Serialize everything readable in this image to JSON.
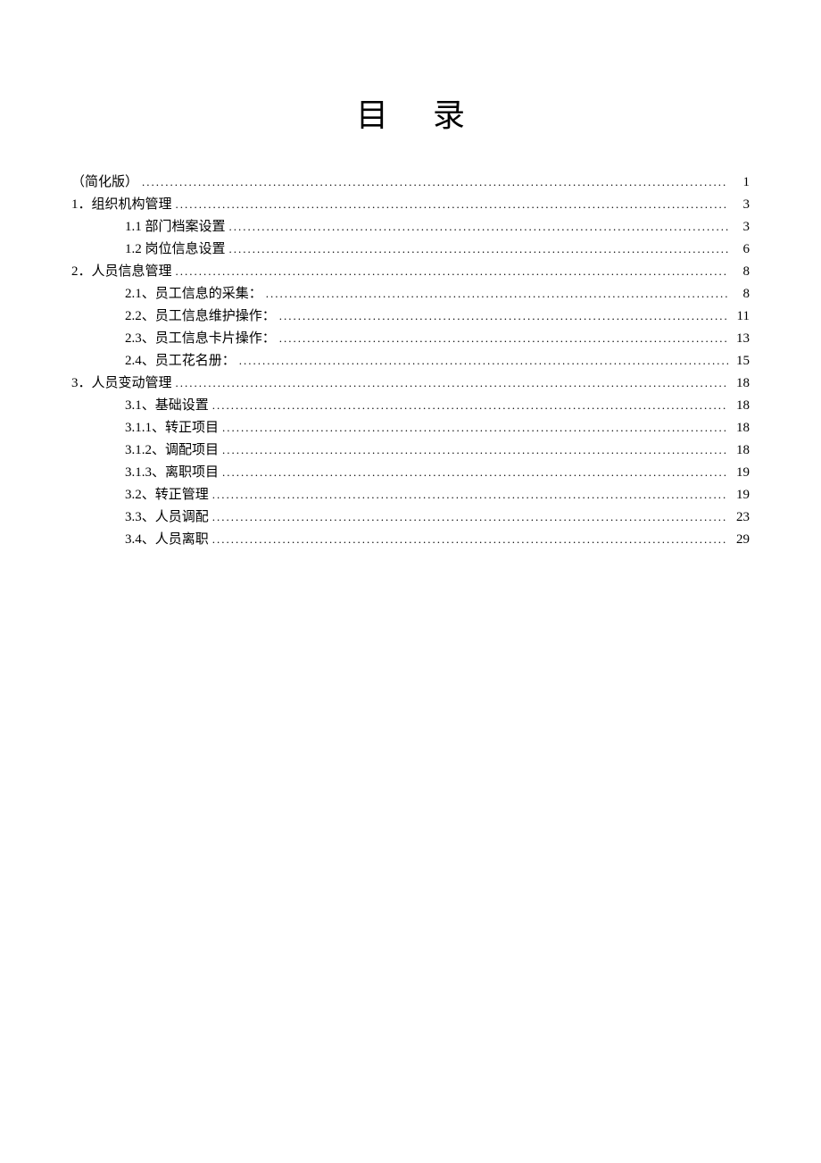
{
  "title": "目录",
  "entries": [
    {
      "level": 0,
      "label": "（简化版）",
      "page": "1"
    },
    {
      "level": 0,
      "label": "1．组织机构管理",
      "page": "3"
    },
    {
      "level": 1,
      "label": "1.1 部门档案设置",
      "page": "3"
    },
    {
      "level": 1,
      "label": "1.2 岗位信息设置",
      "page": "6"
    },
    {
      "level": 0,
      "label": "2．人员信息管理",
      "page": "8"
    },
    {
      "level": 1,
      "label": "2.1、员工信息的采集：",
      "page": "8"
    },
    {
      "level": 1,
      "label": "2.2、员工信息维护操作：",
      "page": "11"
    },
    {
      "level": 1,
      "label": "2.3、员工信息卡片操作：",
      "page": "13"
    },
    {
      "level": 1,
      "label": "2.4、员工花名册：",
      "page": "15"
    },
    {
      "level": 0,
      "label": "3．人员变动管理",
      "page": "18"
    },
    {
      "level": 1,
      "label": "3.1、基础设置",
      "page": "18"
    },
    {
      "level": 1,
      "label": "3.1.1、转正项目",
      "page": "18"
    },
    {
      "level": 1,
      "label": "3.1.2、调配项目",
      "page": "18"
    },
    {
      "level": 1,
      "label": "3.1.3、离职项目",
      "page": "19"
    },
    {
      "level": 1,
      "label": "3.2、转正管理",
      "page": "19"
    },
    {
      "level": 1,
      "label": "3.3、人员调配",
      "page": "23"
    },
    {
      "level": 1,
      "label": "3.4、人员离职",
      "page": "29"
    }
  ]
}
